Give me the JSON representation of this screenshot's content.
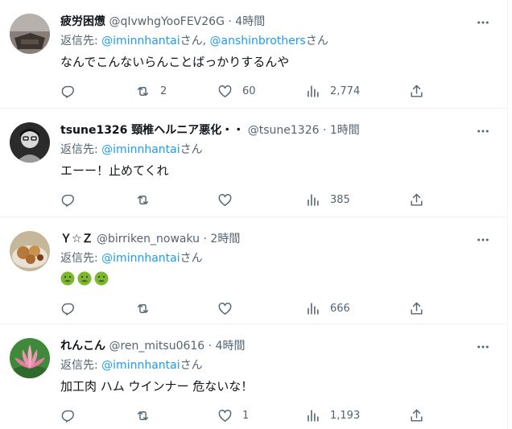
{
  "tweets": [
    {
      "name": "疲労困憊",
      "handle": "@qIvwhgYooFEV26G",
      "dot": "·",
      "time": "4時間",
      "reply_label": "返信先: ",
      "reply_to_1": "@iminnhantai",
      "reply_sep": "さん, ",
      "reply_to_2": "@anshinbrothers",
      "reply_suffix": "さん",
      "text": "なんでこんないらんことばっかりするんや",
      "retweets": "2",
      "likes": "60",
      "views": "2,774"
    },
    {
      "name": "tsune1326 頸椎ヘルニア悪化・・",
      "handle": "@tsune1326",
      "dot": "·",
      "time": "1時間",
      "reply_label": "返信先: ",
      "reply_to_1": "@iminnhantai",
      "reply_suffix": "さん",
      "text": "エーー！止めてくれ",
      "views": "385"
    },
    {
      "name": "Ｙ☆Ｚ",
      "handle": "@birriken_nowaku",
      "dot": "·",
      "time": "2時間",
      "reply_label": "返信先: ",
      "reply_to_1": "@iminnhantai",
      "reply_suffix": "さん",
      "emoji_name": "nauseated-face-emoji",
      "emoji_color": "#7bb82f",
      "views": "666"
    },
    {
      "name": "れんこん",
      "handle": "@ren_mitsu0616",
      "dot": "·",
      "time": "4時間",
      "reply_label": "返信先: ",
      "reply_to_1": "@iminnhantai",
      "reply_suffix": "さん",
      "text": "加工肉 ハム ウインナー 危ないな！",
      "likes": "1",
      "views": "1,193"
    }
  ],
  "colors": {
    "link": "#1d9bf0",
    "secondary": "#536471",
    "primary": "#0f1419",
    "divider": "#eff3f4"
  },
  "icons": [
    "more-icon",
    "reply-icon",
    "retweet-icon",
    "like-icon",
    "views-icon",
    "share-icon"
  ]
}
